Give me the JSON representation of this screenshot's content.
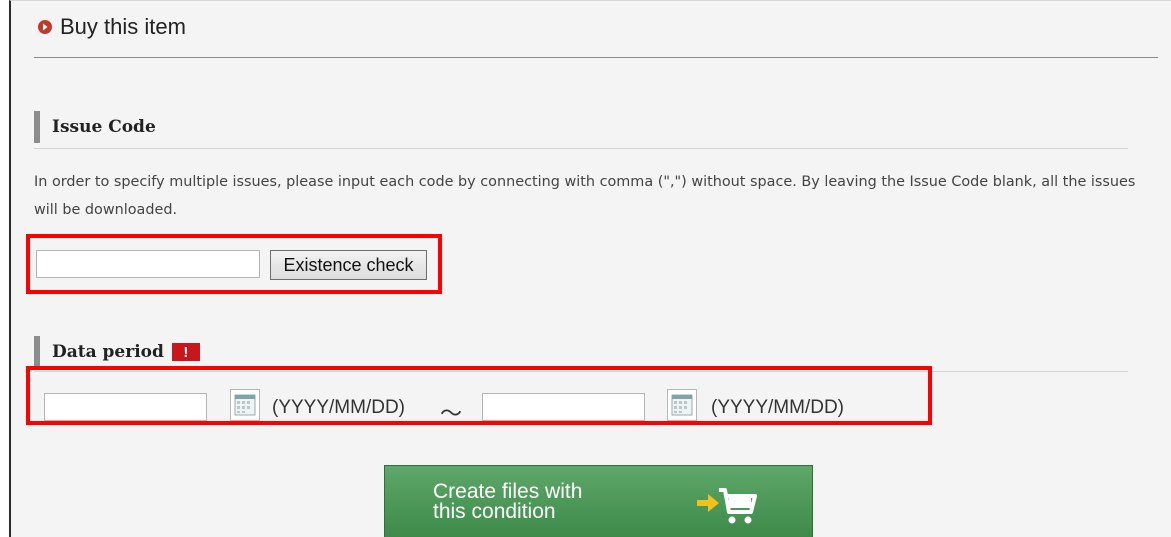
{
  "header": {
    "title": "Buy this item",
    "icon": "circle-arrow-right-icon"
  },
  "issue_code": {
    "title": "Issue Code",
    "description": "In order to specify multiple issues, please input each code by connecting with comma (\",\") without space. By leaving the Issue Code blank, all the issues will be downloaded.",
    "input_value": "",
    "check_button_label": "Existence check"
  },
  "data_period": {
    "title": "Data period",
    "required_badge": "!",
    "start_value": "",
    "start_format": "(YYYY/MM/DD)",
    "separator": "～",
    "end_value": "",
    "end_format": "(YYYY/MM/DD)",
    "calendar_icon": "calendar-icon"
  },
  "actions": {
    "create_label": "Create files with\nthis condition",
    "create_icon": "cart-icon",
    "arrow_icon": "arrow-right-icon"
  },
  "colors": {
    "highlight": "#ff0000",
    "accent_red": "#c0392b",
    "button_green": "#4a9a56",
    "badge_red": "#c8161d"
  }
}
